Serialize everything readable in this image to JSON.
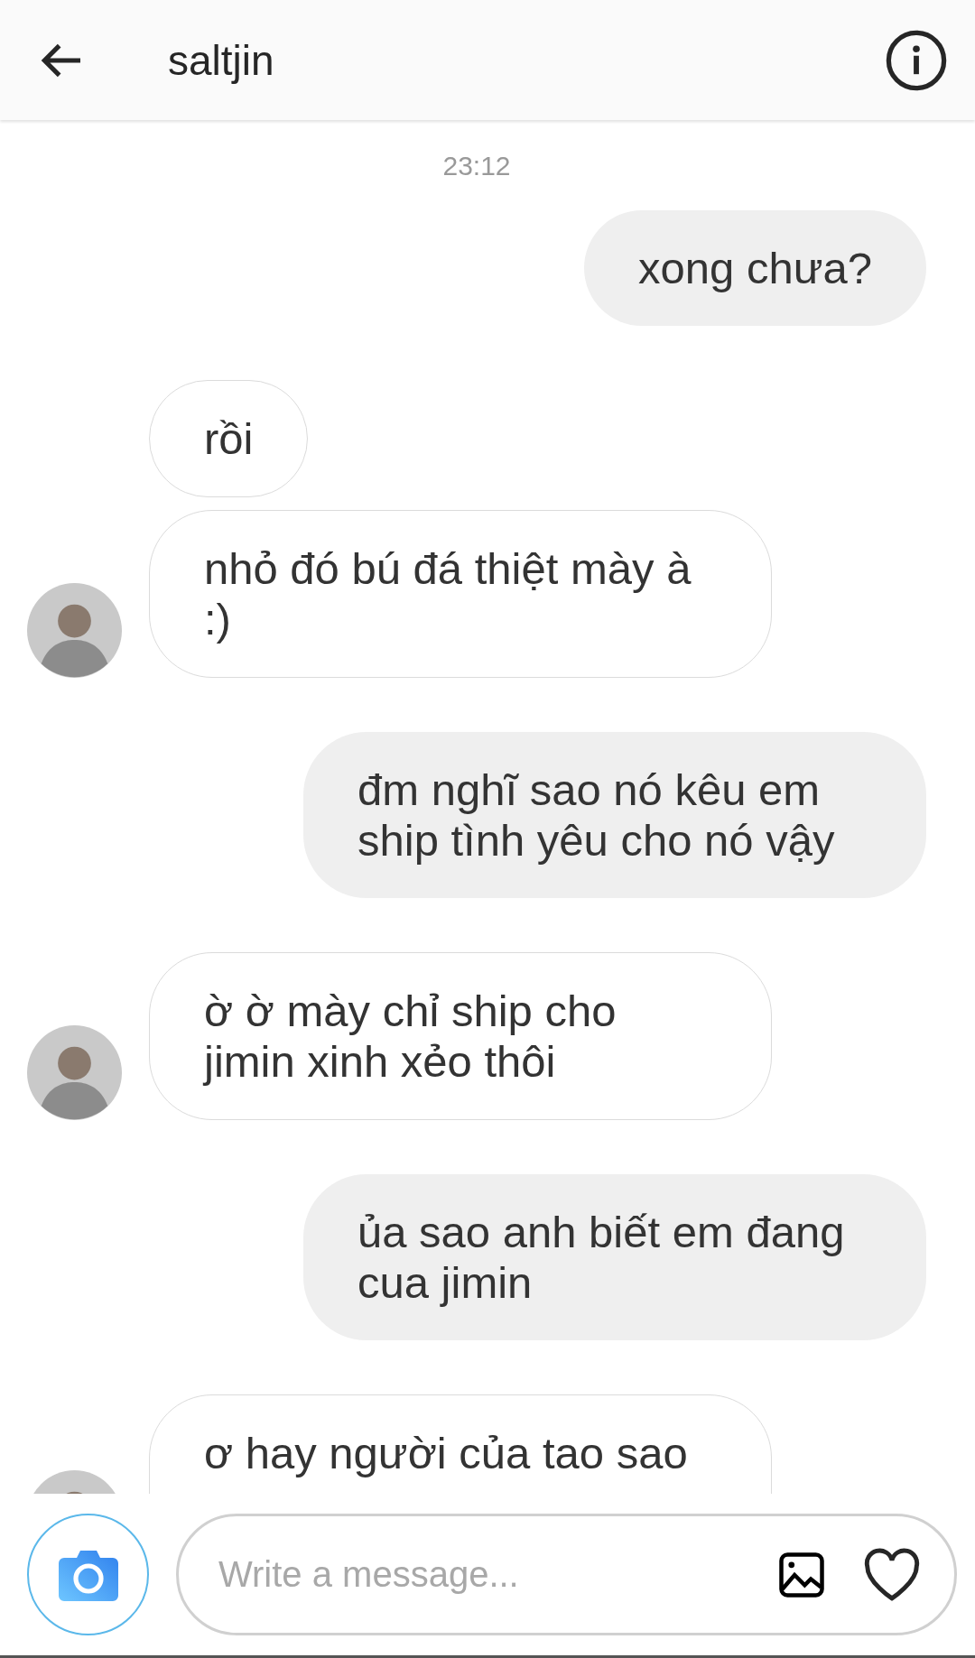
{
  "header": {
    "title": "saltjin"
  },
  "timestamp": "23:12",
  "messages": [
    {
      "kind": "sent",
      "text": "xong chưa?"
    },
    {
      "kind": "received",
      "text": "rồi"
    },
    {
      "kind": "received",
      "text": "nhỏ đó bú đá thiệt mày à :)"
    },
    {
      "kind": "sent",
      "text": "đm nghĩ sao nó kêu em ship tình yêu cho nó vậy"
    },
    {
      "kind": "received",
      "text": "ờ ờ mày chỉ ship cho jimin xinh xẻo thôi"
    },
    {
      "kind": "sent",
      "text": "ủa sao anh biết em đang cua jimin"
    },
    {
      "kind": "received",
      "text": "ơ hay người của tao sao"
    }
  ],
  "composer": {
    "placeholder": "Write a message..."
  }
}
